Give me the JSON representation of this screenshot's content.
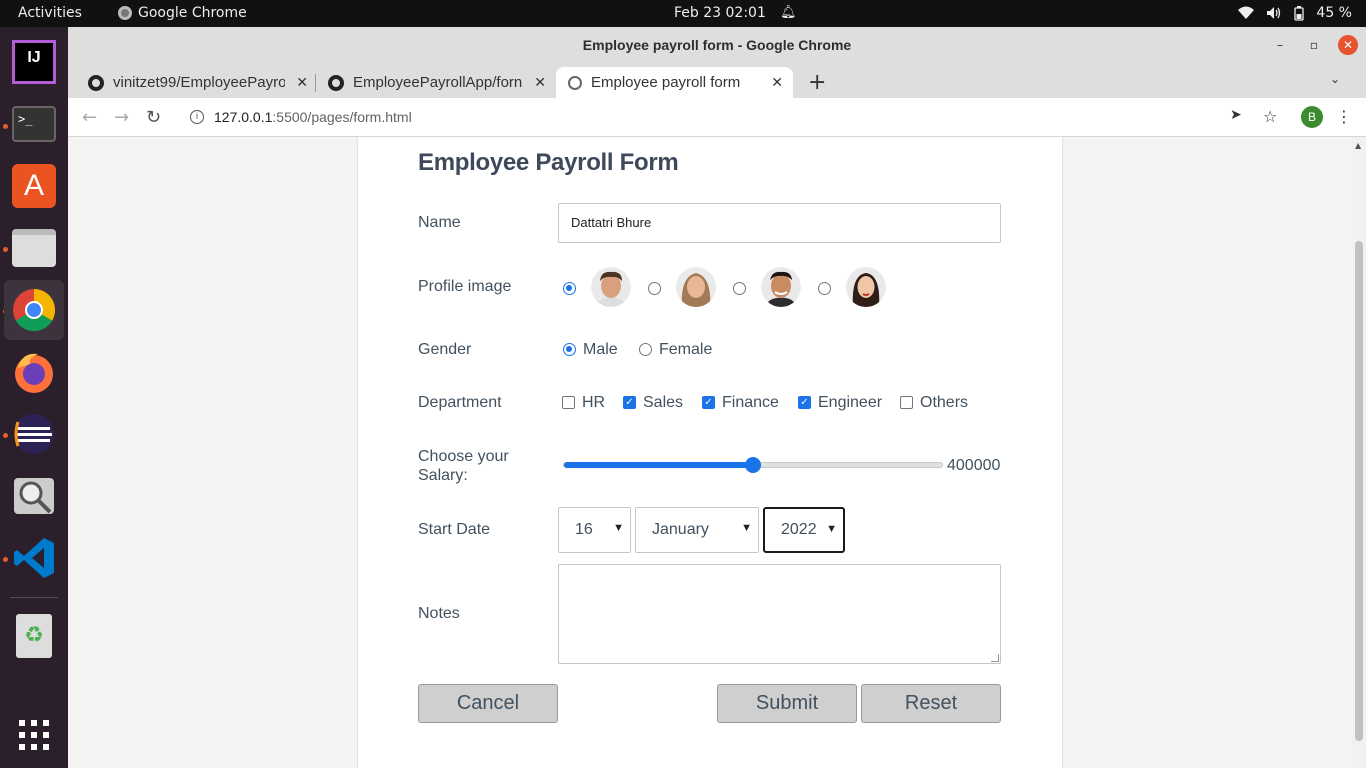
{
  "topbar": {
    "activities": "Activities",
    "app_name": "Google Chrome",
    "datetime": "Feb 23  02:01",
    "battery": "45 %"
  },
  "dock": {
    "items": [
      "intellij-icon",
      "terminal-icon",
      "software-store-icon",
      "files-icon",
      "chrome-icon",
      "firefox-icon",
      "eclipse-icon",
      "magnifier-icon",
      "vscode-icon",
      "trash-icon",
      "app-grid-icon"
    ]
  },
  "window": {
    "title": "Employee payroll form - Google Chrome"
  },
  "tabs": [
    {
      "title": "vinitzet99/EmployeePayro"
    },
    {
      "title": "EmployeePayrollApp/forn"
    },
    {
      "title": "Employee payroll form"
    }
  ],
  "address": {
    "host": "127.0.0.1",
    "path": ":5500/pages/form.html"
  },
  "profile_initial": "B",
  "form": {
    "title": "Employee Payroll Form",
    "name_label": "Name",
    "name_value": "Dattatri Bhure",
    "profile_label": "Profile image",
    "profile_selected_index": 0,
    "gender_label": "Gender",
    "gender_options": [
      "Male",
      "Female"
    ],
    "gender_selected": "Male",
    "department_label": "Department",
    "departments": [
      {
        "label": "HR",
        "checked": false
      },
      {
        "label": "Sales",
        "checked": true
      },
      {
        "label": "Finance",
        "checked": true
      },
      {
        "label": "Engineer",
        "checked": true
      },
      {
        "label": "Others",
        "checked": false
      }
    ],
    "salary_label_line1": "Choose your",
    "salary_label_line2": "Salary:",
    "salary_value": "400000",
    "salary_fraction": 0.5,
    "start_date_label": "Start Date",
    "day": "16",
    "month": "January",
    "year": "2022",
    "notes_label": "Notes",
    "notes_value": "",
    "cancel_label": "Cancel",
    "submit_label": "Submit",
    "reset_label": "Reset"
  },
  "colors": {
    "accent": "#1a73e8",
    "button_bg": "#cfcfcf",
    "label_text": "#42515f",
    "dock_bg": "#2a1f2a"
  }
}
